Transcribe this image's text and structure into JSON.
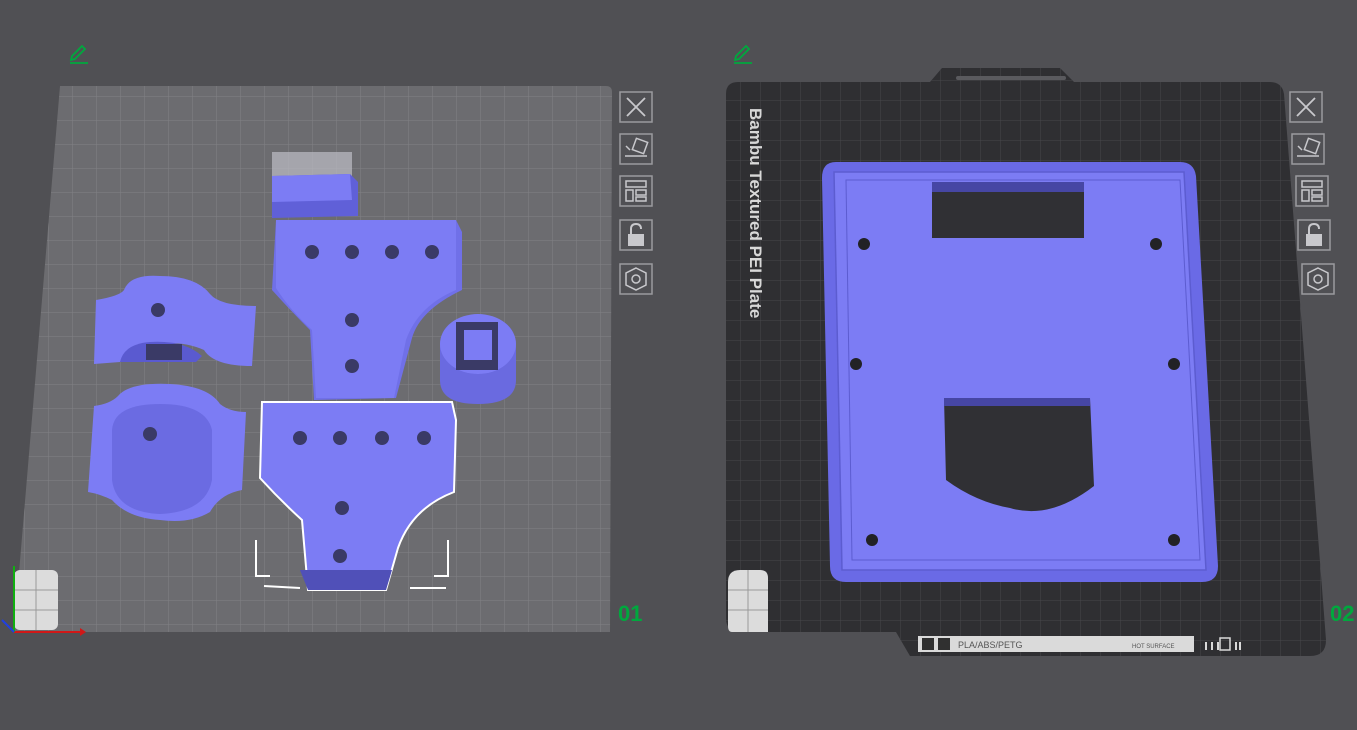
{
  "plates": [
    {
      "number": "01",
      "edit_icon": "pencil-icon",
      "toolbar": [
        "close-icon",
        "auto-orient-icon",
        "arrange-icon",
        "lock-icon",
        "settings-icon"
      ]
    },
    {
      "number": "02",
      "edit_icon": "pencil-icon",
      "plate_label": "Bambu Textured PEI Plate",
      "filament_strip": {
        "filament": "PLA/ABS/PETG",
        "hot_surface": "HOT SURFACE"
      },
      "toolbar": [
        "close-icon",
        "auto-orient-icon",
        "arrange-icon",
        "lock-icon",
        "settings-icon"
      ]
    }
  ],
  "colors": {
    "background": "#505054",
    "plate1_bed": "#6b6b6f",
    "plate2_bed": "#2e2e31",
    "model": "#7c7cf4",
    "plate_number": "#00a83e",
    "selection": "#ffffff"
  }
}
